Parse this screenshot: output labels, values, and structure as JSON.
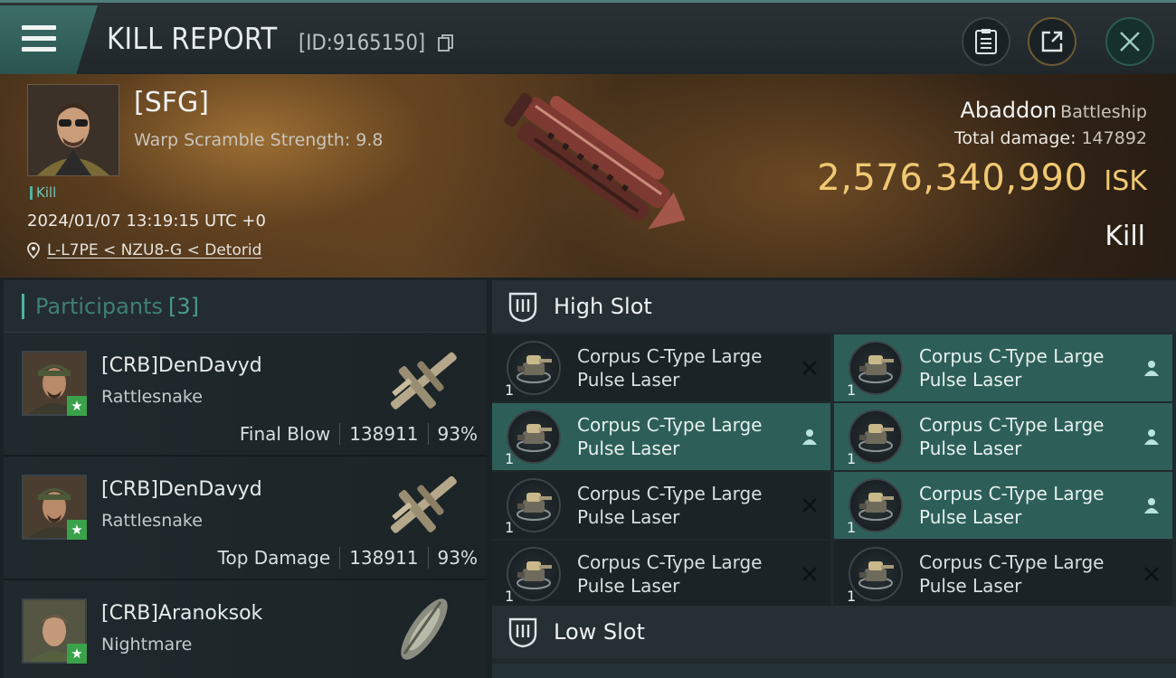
{
  "header": {
    "title": "KILL REPORT",
    "report_id": "[ID:9165150]",
    "icons": [
      "menu-icon",
      "copy-icon",
      "report-icon",
      "share-icon",
      "close-icon"
    ]
  },
  "victim": {
    "corp_tag": "[SFG]",
    "warp_scramble": "Warp Scramble Strength: 9.8",
    "kill_badge": "Kill",
    "datetime": "2024/01/07 13:19:15 UTC +0",
    "location": "L-L7PE < NZU8-G < Detorid",
    "ship_name": "Abaddon",
    "ship_class": "Battleship",
    "total_damage_label": "Total damage:",
    "total_damage": "147892",
    "isk_value": "2,576,340,990",
    "isk_unit": "ISK",
    "kill_type": "Kill"
  },
  "participants": {
    "label": "Participants",
    "count": "[3]",
    "rows": [
      {
        "name": "[CRB]DenDavyd",
        "ship": "Rattlesnake",
        "role": "Final Blow",
        "damage": "138911",
        "percent": "93%"
      },
      {
        "name": "[CRB]DenDavyd",
        "ship": "Rattlesnake",
        "role": "Top Damage",
        "damage": "138911",
        "percent": "93%"
      },
      {
        "name": "[CRB]Aranoksok",
        "ship": "Nightmare",
        "role": "",
        "damage": "",
        "percent": ""
      }
    ]
  },
  "fitting": {
    "high_slot_label": "High Slot",
    "low_slot_label": "Low Slot",
    "modules": [
      {
        "line1": "Corpus C-Type Large",
        "line2": "Pulse Laser",
        "qty": "1",
        "state": "destroyed"
      },
      {
        "line1": "Corpus C-Type Large",
        "line2": "Pulse Laser",
        "qty": "1",
        "state": "dropped"
      },
      {
        "line1": "Corpus C-Type Large",
        "line2": "Pulse Laser",
        "qty": "1",
        "state": "dropped"
      },
      {
        "line1": "Corpus C-Type Large",
        "line2": "Pulse Laser",
        "qty": "1",
        "state": "dropped"
      },
      {
        "line1": "Corpus C-Type Large",
        "line2": "Pulse Laser",
        "qty": "1",
        "state": "destroyed"
      },
      {
        "line1": "Corpus C-Type Large",
        "line2": "Pulse Laser",
        "qty": "1",
        "state": "dropped"
      },
      {
        "line1": "Corpus C-Type Large",
        "line2": "Pulse Laser",
        "qty": "1",
        "state": "destroyed"
      },
      {
        "line1": "Corpus C-Type Large",
        "line2": "Pulse Laser",
        "qty": "1",
        "state": "destroyed"
      }
    ]
  },
  "colors": {
    "accent_teal": "#4fb3a0",
    "isk_gold": "#f0c873",
    "fitted_row": "#2d5f58"
  }
}
